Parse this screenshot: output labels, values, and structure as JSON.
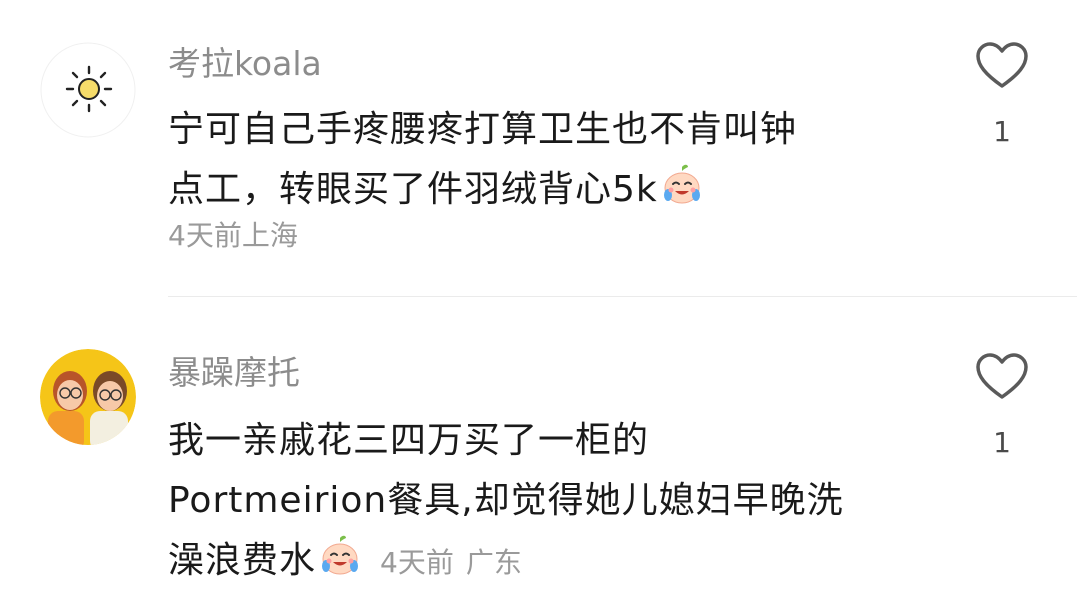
{
  "comments": [
    {
      "username": "考拉koala",
      "content_lines": [
        "宁可自己手疼腰疼打算卫生也不肯叫钟",
        "点工，转眼买了件羽绒背心5k"
      ],
      "emoji": "crying-face-emoji",
      "time": "4天前",
      "location": "上海",
      "likes": "1",
      "avatar": "sun-avatar"
    },
    {
      "username": "暴躁摩托",
      "content_lines": [
        "我一亲戚花三四万买了一柜的",
        "Portmeirion餐具,却觉得她儿媳妇早晚洗",
        "澡浪费水"
      ],
      "emoji": "crying-face-emoji",
      "time": "4天前",
      "location": "广东",
      "likes": "1",
      "avatar": "two-people-avatar"
    }
  ],
  "colors": {
    "username": "#8c8c8c",
    "meta": "#9a9a9a",
    "text": "#1a1a1a",
    "divider": "#ebebeb"
  }
}
